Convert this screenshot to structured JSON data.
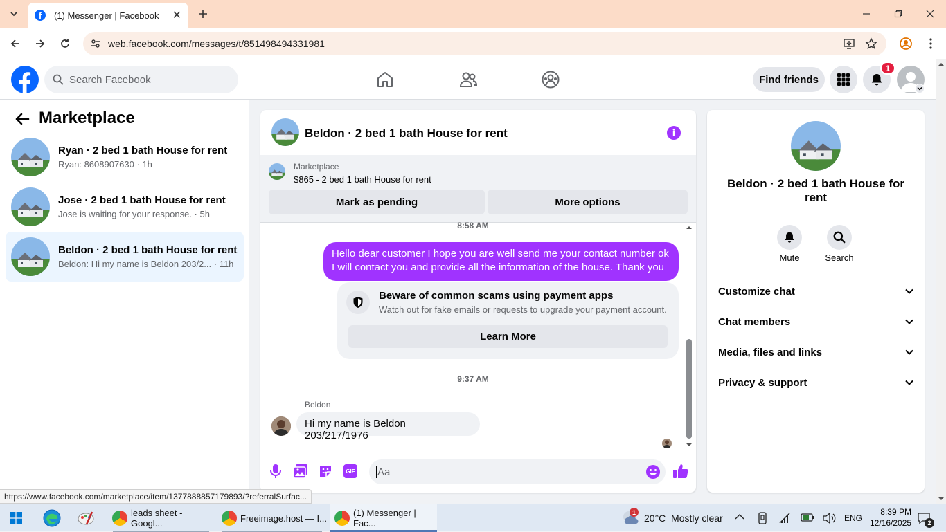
{
  "browser": {
    "tab_title": "(1) Messenger | Facebook",
    "url": "web.facebook.com/messages/t/851498494331981",
    "status_url": "https://www.facebook.com/marketplace/item/1377888857179893/?referralSurfac..."
  },
  "header": {
    "search_placeholder": "Search Facebook",
    "find_friends": "Find friends",
    "notification_count": "1"
  },
  "sidebar": {
    "title": "Marketplace",
    "conversations": [
      {
        "name": "Ryan · 2 bed 1 bath House for rent",
        "preview": "Ryan: 8608907630 · 1h"
      },
      {
        "name": "Jose · 2 bed 1 bath House for rent",
        "preview": "Jose is waiting for your response. · 5h"
      },
      {
        "name": "Beldon · 2 bed 1 bath House for rent",
        "preview": "Beldon: Hi my name is Beldon 203/2... · 11h"
      }
    ]
  },
  "chat": {
    "title": "Beldon · 2 bed 1 bath House for rent",
    "listing_source": "Marketplace",
    "listing_text": "$865 - 2 bed 1 bath House for rent",
    "mark_pending": "Mark as pending",
    "more_options": "More options",
    "time1": "8:58 AM",
    "sent_message": "Hello dear customer I hope you are well send me your contact number ok I will contact you and provide all the information of the house. Thank you",
    "warning_title": "Beware of common scams using payment apps",
    "warning_text": "Watch out for fake emails or requests to upgrade your payment account.",
    "learn_more": "Learn More",
    "time2": "9:37 AM",
    "sender_name": "Beldon",
    "received_message": "Hi my name is Beldon 203/217/1976",
    "input_placeholder": "Aa",
    "gif_label": "GIF"
  },
  "info_panel": {
    "title": "Beldon · 2 bed 1 bath House for rent",
    "mute": "Mute",
    "search": "Search",
    "menu": [
      "Customize chat",
      "Chat members",
      "Media, files and links",
      "Privacy & support"
    ]
  },
  "taskbar": {
    "items": [
      "leads sheet - Googl...",
      "Freeimage.host — I...",
      "(1) Messenger | Fac..."
    ],
    "weather_badge": "1",
    "weather": "20°C  Mostly clear",
    "lang": "ENG",
    "time": "8:39 PM",
    "date": "12/16/2025",
    "notif_count": "2"
  },
  "colors": {
    "facebook_blue": "#0866ff",
    "messenger_purple": "#a033ff",
    "badge_red": "#e41e3f"
  }
}
